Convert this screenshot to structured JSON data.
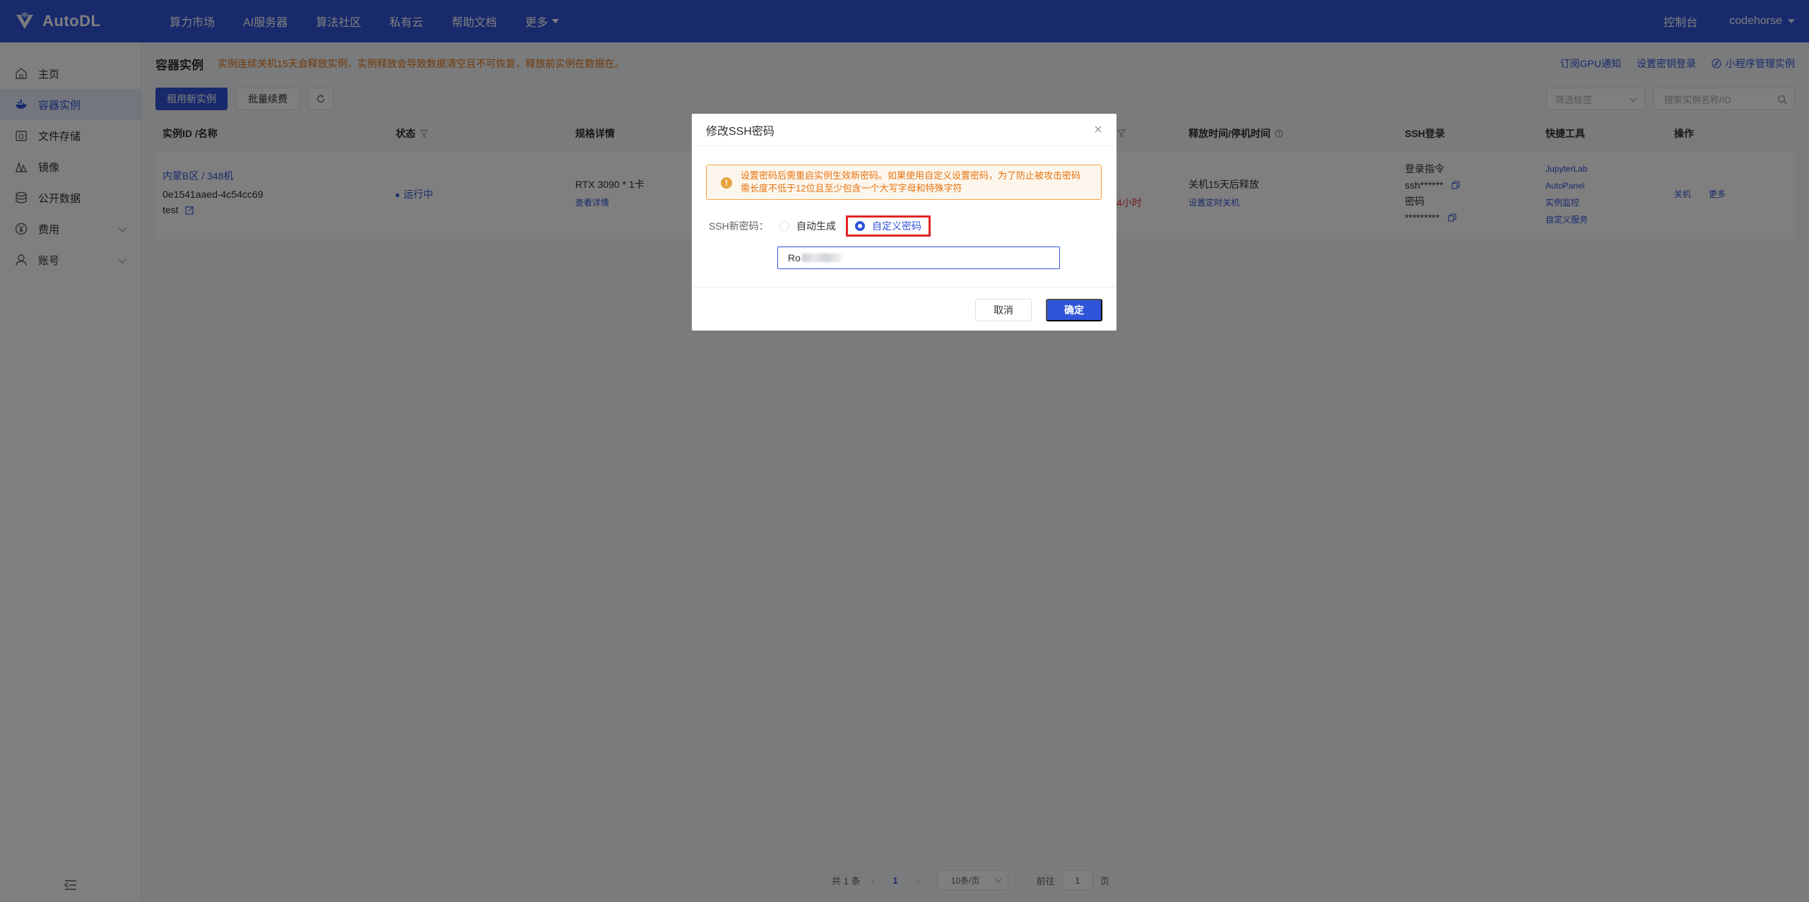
{
  "brand": {
    "name": "AutoDL"
  },
  "nav": {
    "items": [
      "算力市场",
      "AI服务器",
      "算法社区",
      "私有云",
      "帮助文档",
      "更多"
    ],
    "console": "控制台",
    "user": "codehorse"
  },
  "sidebar": {
    "items": [
      {
        "label": "主页",
        "icon": "home-icon"
      },
      {
        "label": "容器实例",
        "icon": "container-icon"
      },
      {
        "label": "文件存储",
        "icon": "storage-icon"
      },
      {
        "label": "镜像",
        "icon": "image-icon"
      },
      {
        "label": "公开数据",
        "icon": "database-icon"
      },
      {
        "label": "费用",
        "icon": "yen-icon"
      },
      {
        "label": "账号",
        "icon": "user-icon"
      }
    ],
    "active": "容器实例"
  },
  "page": {
    "title": "容器实例",
    "warning": "实例连续关机15天会释放实例，实例释放会导致数据清空且不可恢复，释放前实例在数据在。",
    "links": [
      "订阅GPU通知",
      "设置密钥登录",
      "小程序管理实例"
    ],
    "rent_button": "租用新实例",
    "renew_button": "批量续费",
    "filter_placeholder": "筛选标签",
    "search_placeholder": "搜索实例名称/ID"
  },
  "table": {
    "headers": [
      "实例ID /名称",
      "状态",
      "规格详情",
      "释放时间/停机时间",
      "SSH登录",
      "快捷工具",
      "操作"
    ],
    "row": {
      "region": "内蒙B区 / 348机",
      "instance_id": "0e1541aaed-4c54cc69",
      "name": "test",
      "status": "运行中",
      "spec": "RTX 3090 * 1卡",
      "spec_detail": "查看详情",
      "hidden_remaining": "4小时",
      "release": "关机15天后释放",
      "release_link": "设置定时关机",
      "ssh_cmd_label": "登录指令",
      "ssh_cmd": "ssh******",
      "pwd_label": "密码",
      "pwd": "*********",
      "tools": [
        "JupyterLab",
        "AutoPanel",
        "实例监控",
        "自定义服务"
      ],
      "actions": [
        "关机",
        "更多"
      ]
    }
  },
  "pagination": {
    "total": "共 1 条",
    "current": "1",
    "page_size": "10条/页",
    "goto_label": "前往",
    "goto_value": "1",
    "page_unit": "页"
  },
  "dialog": {
    "title": "修改SSH密码",
    "alert": "设置密码后需重启实例生效新密码。如果使用自定义设置密码，为了防止被攻击密码需长度不低于12位且至少包含一个大写字母和特殊字符",
    "field_label": "SSH新密码：",
    "option_auto": "自动生成",
    "option_custom": "自定义密码",
    "password_prefix": "Ro",
    "cancel": "取消",
    "confirm": "确定"
  },
  "colors": {
    "primary": "#3054d8",
    "warning": "#e6730f",
    "highlight": "#e02424"
  }
}
